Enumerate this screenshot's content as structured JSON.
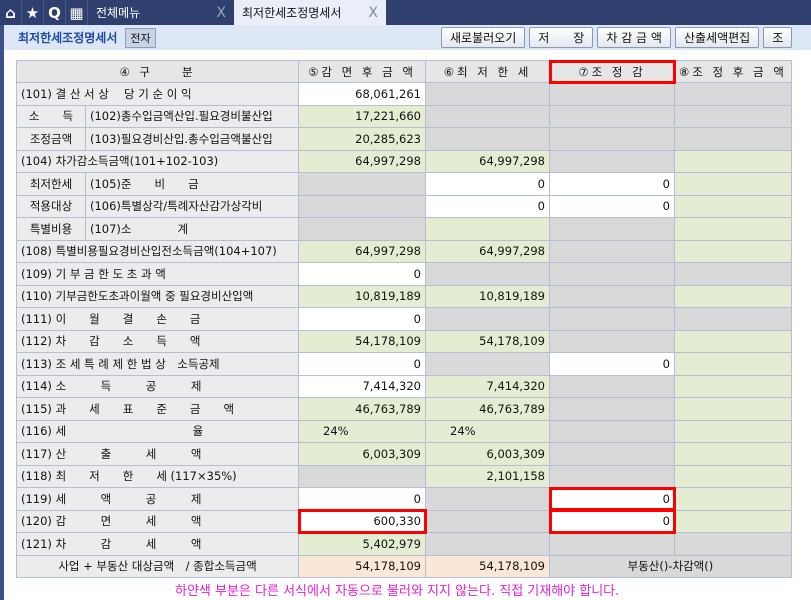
{
  "topbar": {
    "menu_tab": "전체메뉴",
    "active_tab": "최저한세조정명세서",
    "close": "X"
  },
  "subbar": {
    "title": "최저한세조정명세서",
    "badge": "전자",
    "buttons": [
      "새로불러오기",
      "저　　장",
      "차 감 금 액",
      "산출세액편집",
      "조"
    ]
  },
  "table": {
    "headers": [
      "④ 구　　분",
      "⑤감 면 후 금 액",
      "⑥최 저 한 세",
      "⑦조 정 감",
      "⑧조 정 후 금 액"
    ],
    "rows": [
      {
        "label": "(101) 결 산 서 상　 당 기 순 이 익",
        "cells": [
          [
            "w",
            "68,061,261"
          ],
          [
            "n",
            ""
          ],
          [
            "n",
            ""
          ],
          [
            "n",
            ""
          ]
        ]
      },
      {
        "group": "소　　득",
        "label": "(102)총수입금액산입.필요경비불산입",
        "cells": [
          [
            "g",
            "17,221,660"
          ],
          [
            "n",
            ""
          ],
          [
            "n",
            ""
          ],
          [
            "n",
            ""
          ]
        ]
      },
      {
        "group": "조정금액",
        "label": "(103)필요경비산입.총수입금액불산입",
        "cells": [
          [
            "g",
            "20,285,623"
          ],
          [
            "n",
            ""
          ],
          [
            "n",
            ""
          ],
          [
            "n",
            ""
          ]
        ]
      },
      {
        "label": "(104) 차가감소득금액(101+102-103)",
        "cells": [
          [
            "g",
            "64,997,298"
          ],
          [
            "g",
            "64,997,298"
          ],
          [
            "n",
            ""
          ],
          [
            "g",
            ""
          ]
        ]
      },
      {
        "group": "최저한세",
        "label": "(105)준　　비　　금",
        "cells": [
          [
            "n",
            ""
          ],
          [
            "w",
            "0"
          ],
          [
            "w",
            "0"
          ],
          [
            "g",
            ""
          ]
        ]
      },
      {
        "group": "적용대상",
        "label": "(106)특별상각/특례자산감가상각비",
        "cells": [
          [
            "n",
            ""
          ],
          [
            "w",
            "0"
          ],
          [
            "w",
            "0"
          ],
          [
            "g",
            ""
          ]
        ]
      },
      {
        "group": "특별비용",
        "label": "(107)소　　　　계",
        "cells": [
          [
            "n",
            ""
          ],
          [
            "g",
            ""
          ],
          [
            "n",
            ""
          ],
          [
            "g",
            ""
          ]
        ]
      },
      {
        "label": "(108) 특별비용필요경비산입전소득금액(104+107)",
        "cells": [
          [
            "g",
            "64,997,298"
          ],
          [
            "g",
            "64,997,298"
          ],
          [
            "n",
            ""
          ],
          [
            "g",
            ""
          ]
        ]
      },
      {
        "label": "(109) 기 부 금 한 도 초 과 액",
        "cells": [
          [
            "w",
            "0"
          ],
          [
            "n",
            ""
          ],
          [
            "n",
            ""
          ],
          [
            "n",
            ""
          ]
        ]
      },
      {
        "label": "(110) 기부금한도초과이월액 중 필요경비산입액",
        "cells": [
          [
            "g",
            "10,819,189"
          ],
          [
            "g",
            "10,819,189"
          ],
          [
            "n",
            ""
          ],
          [
            "g",
            ""
          ]
        ]
      },
      {
        "label": "(111) 이　　월　　결　　손　　금",
        "cells": [
          [
            "w",
            "0"
          ],
          [
            "n",
            ""
          ],
          [
            "n",
            ""
          ],
          [
            "n",
            ""
          ]
        ]
      },
      {
        "label": "(112) 차　　감　　소　　득　　액",
        "cells": [
          [
            "g",
            "54,178,109"
          ],
          [
            "g",
            "54,178,109"
          ],
          [
            "n",
            ""
          ],
          [
            "g",
            ""
          ]
        ]
      },
      {
        "label": "(113) 조 세 특 례 제 한 법 상　소득공제",
        "cells": [
          [
            "w",
            "0"
          ],
          [
            "n",
            ""
          ],
          [
            "w",
            "0"
          ],
          [
            "g",
            ""
          ]
        ]
      },
      {
        "label": "(114) 소　　　득　　　공　　　제",
        "cells": [
          [
            "w",
            "7,414,320"
          ],
          [
            "g",
            "7,414,320"
          ],
          [
            "n",
            ""
          ],
          [
            "g",
            ""
          ]
        ]
      },
      {
        "label": "(115) 과　　세　　표　　준　　금　　액",
        "cells": [
          [
            "g",
            "46,763,789"
          ],
          [
            "g",
            "46,763,789"
          ],
          [
            "n",
            ""
          ],
          [
            "g",
            ""
          ]
        ]
      },
      {
        "label": "(116) 세　　　　　　　　　　　율",
        "cells": [
          [
            "gp",
            "24%"
          ],
          [
            "gp",
            "24%"
          ],
          [
            "n",
            ""
          ],
          [
            "g",
            ""
          ]
        ]
      },
      {
        "label": "(117) 산　　　출　　　세　　　액",
        "cells": [
          [
            "g",
            "6,003,309"
          ],
          [
            "g",
            "6,003,309"
          ],
          [
            "n",
            ""
          ],
          [
            "g",
            ""
          ]
        ]
      },
      {
        "label": "(118) 최　　저　　한　　세 (117×35%)",
        "cells": [
          [
            "n",
            ""
          ],
          [
            "g",
            "2,101,158"
          ],
          [
            "n",
            ""
          ],
          [
            "g",
            ""
          ]
        ]
      },
      {
        "label": "(119) 세　　　액　　　공　　　제",
        "cells": [
          [
            "w",
            "0"
          ],
          [
            "n",
            ""
          ],
          [
            "wr",
            "0"
          ],
          [
            "g",
            ""
          ]
        ]
      },
      {
        "label": "(120) 감　　　면　　　세　　　액",
        "cells": [
          [
            "wr",
            "600,330"
          ],
          [
            "n",
            ""
          ],
          [
            "wr",
            "0"
          ],
          [
            "g",
            ""
          ]
        ]
      },
      {
        "label": "(121) 차　　　감　　　세　　　액",
        "cells": [
          [
            "g",
            "5,402,979"
          ],
          [
            "n",
            ""
          ],
          [
            "n",
            ""
          ],
          [
            "n",
            ""
          ]
        ]
      }
    ],
    "footer": {
      "label": "사업 + 부동산 대상금액　/ 종합소득금액",
      "col5": "54,178,109",
      "col6": "54,178,109",
      "col78": "부동산()-차감액()"
    }
  },
  "note": "하얀색 부분은 다른 서식에서 자동으로 불러와 지지 않는다. 직접 기재해야 합니다."
}
